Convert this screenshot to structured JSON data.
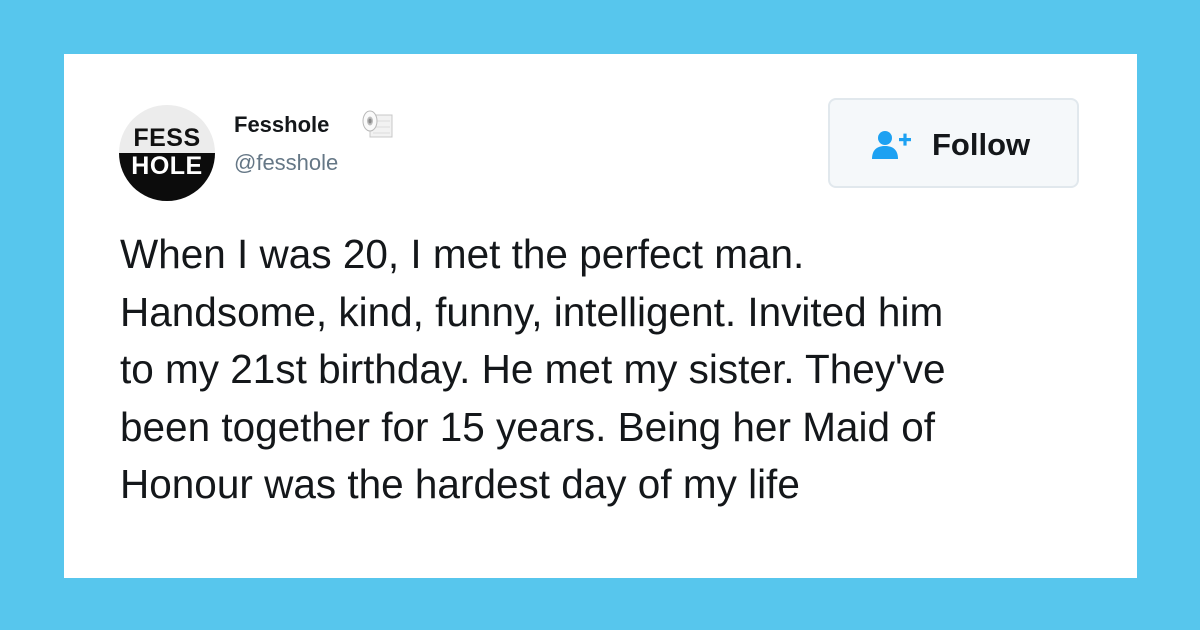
{
  "profile": {
    "avatar_top": "FESS",
    "avatar_bottom": "HOLE",
    "display_name": "Fesshole",
    "badge_icon": "toilet-paper-icon",
    "handle": "@fesshole"
  },
  "follow_button": {
    "label": "Follow",
    "icon": "add-user-icon",
    "accent": "#1da1f2"
  },
  "tweet": {
    "lines": [
      "When I was 20, I met the perfect man.",
      "Handsome, kind, funny, intelligent. Invited him",
      "to my 21st birthday. He met my sister. They've",
      "been together for 15 years. Being her Maid of",
      "Honour was the hardest day of my life"
    ]
  },
  "colors": {
    "background": "#57c6ed",
    "card": "#ffffff",
    "text": "#14171a",
    "secondary_text": "#657786"
  }
}
